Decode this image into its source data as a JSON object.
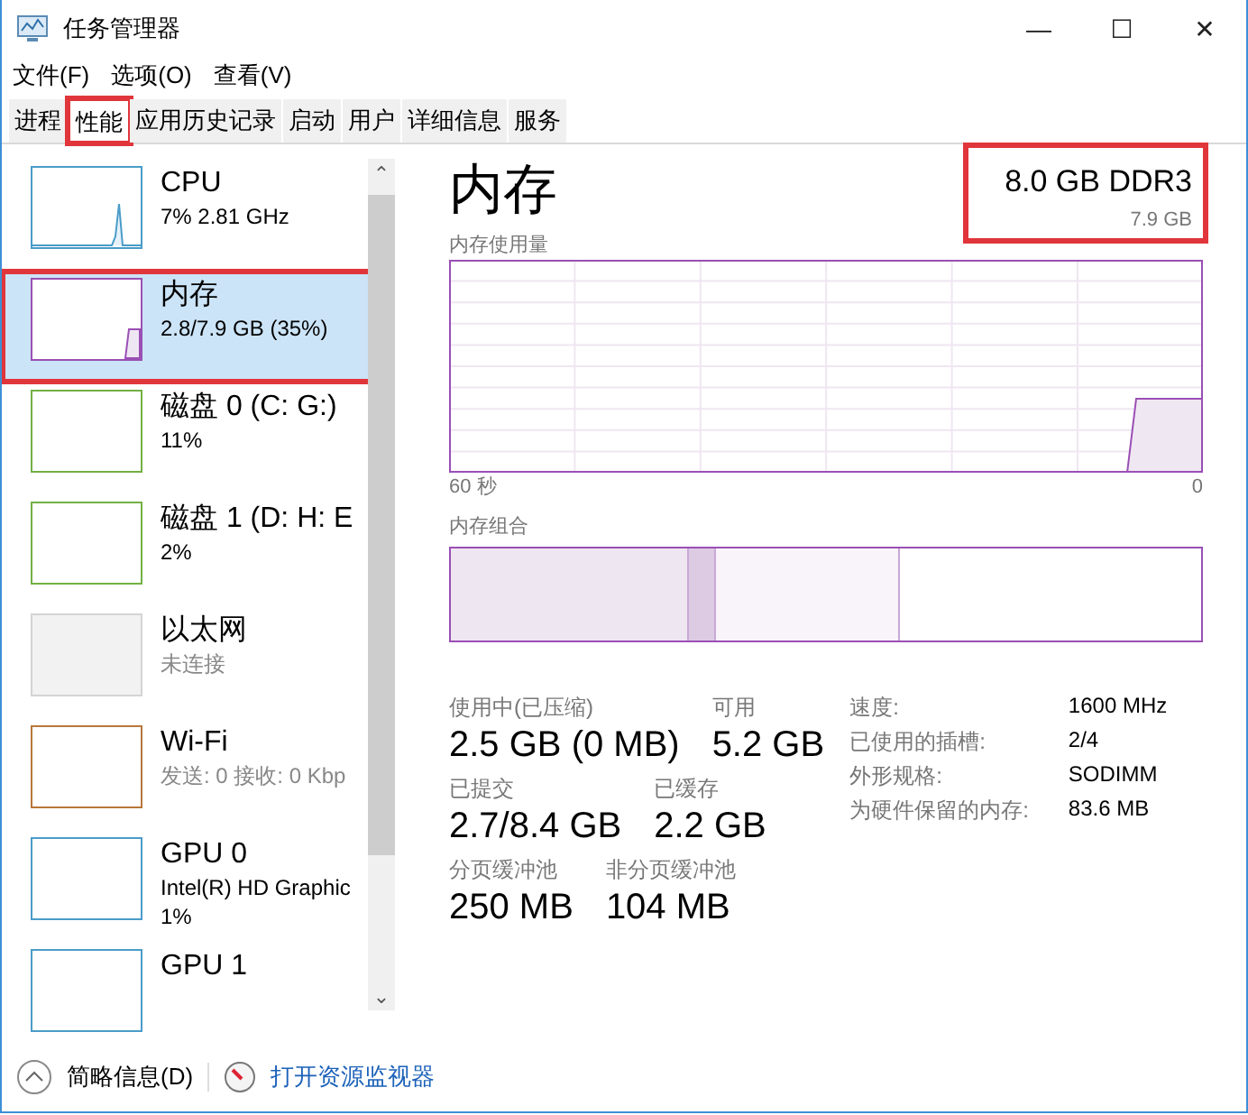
{
  "window": {
    "title": "任务管理器",
    "controls": [
      "—",
      "☐",
      "✕"
    ]
  },
  "menu": [
    "文件(F)",
    "选项(O)",
    "查看(V)"
  ],
  "tabs": [
    {
      "label": "进程",
      "selected": false,
      "highlighted": false
    },
    {
      "label": "性能",
      "selected": true,
      "highlighted": true
    },
    {
      "label": "应用历史记录",
      "selected": false,
      "highlighted": false
    },
    {
      "label": "启动",
      "selected": false,
      "highlighted": false
    },
    {
      "label": "用户",
      "selected": false,
      "highlighted": false
    },
    {
      "label": "详细信息",
      "selected": false,
      "highlighted": false
    },
    {
      "label": "服务",
      "selected": false,
      "highlighted": false
    }
  ],
  "sidebar": {
    "scroll_up": "⌃",
    "scroll_down": "⌄",
    "items": [
      {
        "kind": "spike",
        "name": "CPU",
        "color": "#4a9cc8",
        "inactive": false,
        "selected": false,
        "highlighted": false,
        "details": [
          {
            "text": "7% 2.81 GHz",
            "dim": false
          }
        ]
      },
      {
        "kind": "step",
        "name": "内存",
        "color": "#9a4fb5",
        "inactive": false,
        "selected": true,
        "highlighted": true,
        "details": [
          {
            "text": "2.8/7.9 GB (35%)",
            "dim": false
          }
        ]
      },
      {
        "kind": "flat",
        "name": "磁盘 0 (C: G:)",
        "color": "#72b043",
        "inactive": false,
        "selected": false,
        "highlighted": false,
        "details": [
          {
            "text": "11%",
            "dim": false
          }
        ]
      },
      {
        "kind": "flat",
        "name": "磁盘 1 (D: H: E",
        "color": "#72b043",
        "inactive": false,
        "selected": false,
        "highlighted": false,
        "details": [
          {
            "text": "2%",
            "dim": false
          }
        ]
      },
      {
        "kind": "flat",
        "name": "以太网",
        "color": "#d4d4d4",
        "inactive": true,
        "selected": false,
        "highlighted": false,
        "details": [
          {
            "text": "未连接",
            "dim": true
          }
        ]
      },
      {
        "kind": "flat",
        "name": "Wi-Fi",
        "color": "#b8773a",
        "inactive": false,
        "selected": false,
        "highlighted": false,
        "details": [
          {
            "text": "发送: 0 接收: 0 Kbp",
            "dim": true
          }
        ]
      },
      {
        "kind": "flat",
        "name": "GPU 0",
        "color": "#4a9cc8",
        "inactive": false,
        "selected": false,
        "highlighted": false,
        "details": [
          {
            "text": "Intel(R) HD Graphic",
            "dim": false
          },
          {
            "text": "1%",
            "dim": false
          }
        ]
      },
      {
        "kind": "flat",
        "name": "GPU 1",
        "color": "#4a9cc8",
        "inactive": false,
        "selected": false,
        "highlighted": false
      }
    ]
  },
  "panel": {
    "title": "内存",
    "capacity": "8.0 GB DDR3",
    "capacity_highlighted": true,
    "usage_label": "内存使用量",
    "usage_max": "7.9 GB",
    "time_start": "60 秒",
    "time_end": "0",
    "composition_label": "内存组合",
    "stats": [
      [
        {
          "label": "使用中(已压缩)",
          "value": "2.5 GB (0 MB)"
        },
        {
          "label": "可用",
          "value": "5.2 GB"
        }
      ],
      [
        {
          "label": "已提交",
          "value": "2.7/8.4 GB"
        },
        {
          "label": "已缓存",
          "value": "2.2 GB"
        }
      ],
      [
        {
          "label": "分页缓冲池",
          "value": "250 MB"
        },
        {
          "label": "非分页缓冲池",
          "value": "104 MB"
        }
      ]
    ],
    "specs": [
      {
        "label": "速度:",
        "value": "1600 MHz"
      },
      {
        "label": "已使用的插槽:",
        "value": "2/4"
      },
      {
        "label": "外形规格:",
        "value": "SODIMM"
      },
      {
        "label": "为硬件保留的内存:",
        "value": "83.6 MB"
      }
    ]
  },
  "footer": {
    "summary": "简略信息(D)",
    "monitor_link": "打开资源监视器"
  }
}
